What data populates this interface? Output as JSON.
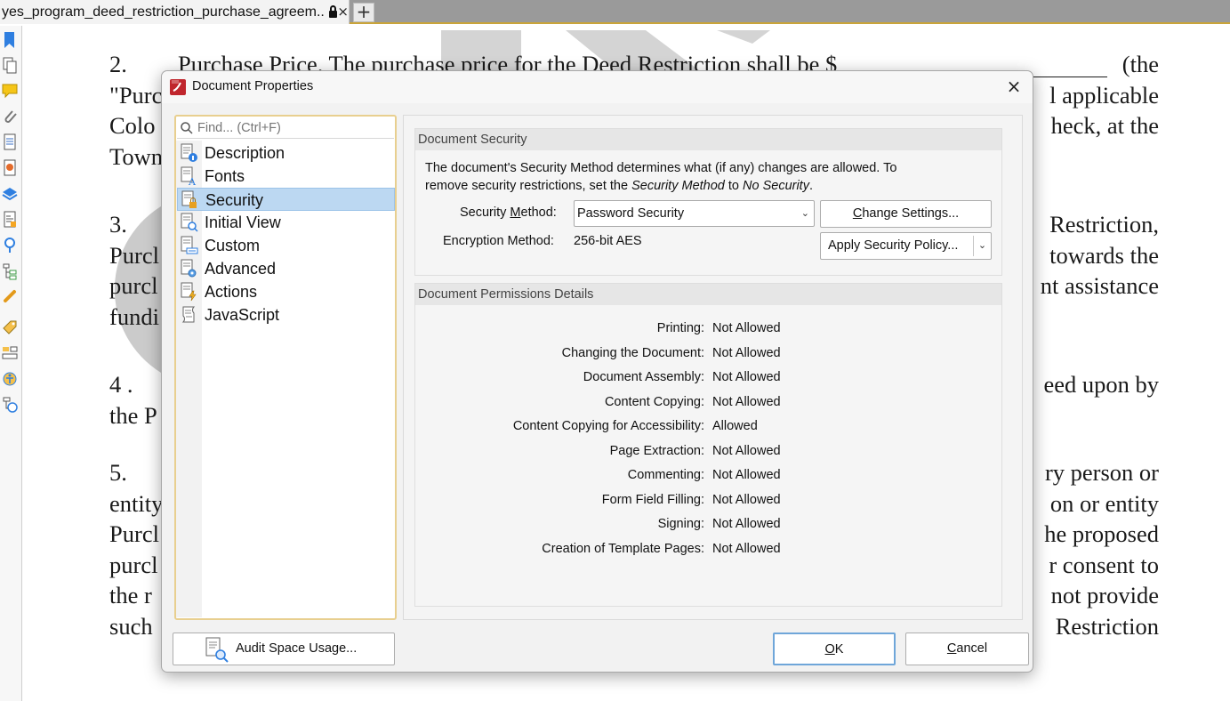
{
  "tab": {
    "title": "yes_program_deed_restriction_purchase_agreem..",
    "close_glyph": "×",
    "new_tab_glyph": "+"
  },
  "sidebar": {
    "icons": [
      "bookmark-icon",
      "page-thumbnails-icon",
      "comments-icon",
      "attachments-icon",
      "document-icon",
      "signature-icon",
      "layers-icon",
      "content-icon",
      "destinations-icon",
      "structure-icon",
      "links-icon",
      "tags-icon",
      "reading-order-icon",
      "accessibility-icon",
      "accessibility-tags-icon"
    ]
  },
  "document": {
    "paragraphs": [
      {
        "lines": [
          {
            "num": "2.",
            "left": "Purchase Price.  The purchase price for the Deed Restriction shall be $",
            "right": "(the"
          },
          {
            "left": "\"Purc",
            "right": "l applicable"
          },
          {
            "left": "Colo",
            "right": "heck, at the"
          },
          {
            "left": "Town",
            "right": ""
          }
        ]
      },
      {
        "lines": [
          {
            "num": "3.",
            "left": "",
            "right": "Restriction,"
          },
          {
            "left": "Purcl",
            "right": "towards the"
          },
          {
            "left": "purcl",
            "right": "nt assistance"
          },
          {
            "left": "fundi",
            "right": ""
          }
        ]
      },
      {
        "lines": [
          {
            "num": "4 .",
            "left": "",
            "right": "eed upon by"
          },
          {
            "left": "the P",
            "right": ""
          }
        ]
      },
      {
        "lines": [
          {
            "num": "5.",
            "left": "",
            "right": "ry person or"
          },
          {
            "left": "entity",
            "right": "on or entity"
          },
          {
            "left": "Purcl",
            "right": "he proposed"
          },
          {
            "left": "purcl",
            "right": "r consent to"
          },
          {
            "left": "the  r",
            "right": "not provide"
          },
          {
            "left": "such",
            "right": "Restriction"
          }
        ]
      }
    ]
  },
  "dialog": {
    "title": "Document Properties",
    "close_glyph": "×",
    "search_placeholder": "Find... (Ctrl+F)",
    "nav_items": [
      {
        "label": "Description",
        "icon": "description-icon",
        "selected": false
      },
      {
        "label": "Fonts",
        "icon": "fonts-icon",
        "selected": false
      },
      {
        "label": "Security",
        "icon": "security-icon",
        "selected": true
      },
      {
        "label": "Initial View",
        "icon": "initial-view-icon",
        "selected": false
      },
      {
        "label": "Custom",
        "icon": "custom-icon",
        "selected": false
      },
      {
        "label": "Advanced",
        "icon": "advanced-icon",
        "selected": false
      },
      {
        "label": "Actions",
        "icon": "actions-icon",
        "selected": false
      },
      {
        "label": "JavaScript",
        "icon": "javascript-icon",
        "selected": false
      }
    ],
    "security": {
      "header": "Document Security",
      "desc_line1": "The document's Security Method determines what (if any) changes are allowed. To",
      "desc_line2_pre": "remove security restrictions, set the ",
      "desc_line2_em1": "Security Method",
      "desc_line2_mid": " to ",
      "desc_line2_em2": "No Security",
      "desc_line2_post": ".",
      "method_label_pre": "Security ",
      "method_label_u": "M",
      "method_label_post": "ethod:",
      "method_value": "Password Security",
      "encryption_label": "Encryption Method:",
      "encryption_value": "256-bit AES",
      "change_settings_u": "C",
      "change_settings_rest": "hange Settings...",
      "apply_policy_label": "Apply Security Policy..."
    },
    "permissions": {
      "header": "Document Permissions Details",
      "items": [
        {
          "label": "Printing:",
          "value": "Not Allowed"
        },
        {
          "label": "Changing the Document:",
          "value": "Not Allowed"
        },
        {
          "label": "Document Assembly:",
          "value": "Not Allowed"
        },
        {
          "label": "Content Copying:",
          "value": "Not Allowed"
        },
        {
          "label": "Content Copying for Accessibility:",
          "value": "Allowed"
        },
        {
          "label": "Page Extraction:",
          "value": "Not Allowed"
        },
        {
          "label": "Commenting:",
          "value": "Not Allowed"
        },
        {
          "label": "Form Field Filling:",
          "value": "Not Allowed"
        },
        {
          "label": "Signing:",
          "value": "Not Allowed"
        },
        {
          "label": "Creation of Template Pages:",
          "value": "Not Allowed"
        }
      ]
    },
    "buttons": {
      "audit": "Audit Space Usage...",
      "ok_u": "O",
      "ok_rest": "K",
      "cancel_u": "C",
      "cancel_rest": "ancel"
    }
  },
  "colors": {
    "accent_border": "#e8cf8f",
    "selection": "#bcd8f2",
    "ok_focus": "#6fa6d9",
    "app_icon": "#c0262d"
  }
}
